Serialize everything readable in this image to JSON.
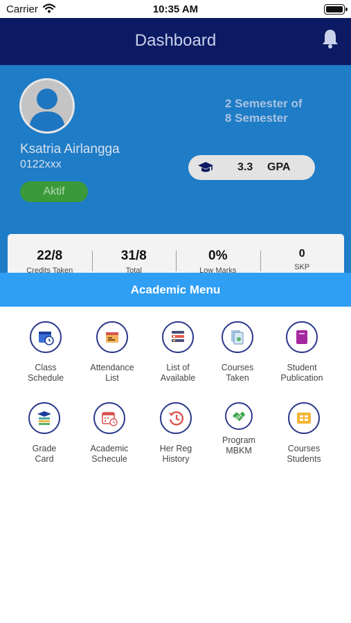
{
  "status_bar": {
    "carrier": "Carrier",
    "time": "10:35 AM"
  },
  "nav": {
    "title": "Dashboard",
    "notification_icon": "bell-icon"
  },
  "profile": {
    "name": "Ksatria Airlangga",
    "id": "0122xxx",
    "status": "Aktif",
    "semester_line1": "2 Semester of",
    "semester_line2": "8 Semester",
    "gpa_value": "3.3",
    "gpa_label": "GPA"
  },
  "stats": [
    {
      "value": "22/8",
      "label": "Credits Taken"
    },
    {
      "value": "31/8",
      "label": "Total"
    },
    {
      "value": "0%",
      "label": "Low Marks"
    },
    {
      "value": "0",
      "label": "SKP"
    }
  ],
  "menu": {
    "title": "Academic Menu",
    "items": [
      {
        "line1": "Class",
        "line2": "Schedule",
        "icon": "calendar-clock-icon"
      },
      {
        "line1": "Attendance",
        "line2": "List",
        "icon": "attendance-icon"
      },
      {
        "line1": "List of",
        "line2": "Available",
        "icon": "list-icon"
      },
      {
        "line1": "Courses",
        "line2": "Taken",
        "icon": "documents-icon"
      },
      {
        "line1": "Student",
        "line2": "Publication",
        "icon": "book-icon"
      },
      {
        "line1": "Grade",
        "line2": "Card",
        "icon": "grade-card-icon"
      },
      {
        "line1": "Academic",
        "line2": "Schecule",
        "icon": "academic-calendar-icon"
      },
      {
        "line1": "Her Reg",
        "line2": "History",
        "icon": "history-icon"
      },
      {
        "line1": "Program",
        "line2": "MBKM",
        "icon": "handshake-icon"
      },
      {
        "line1": "Courses",
        "line2": "Students",
        "icon": "grid-icon"
      }
    ]
  },
  "colors": {
    "nav_bg": "#0c1a63",
    "hero_bg": "#1f7cc6",
    "menu_header_bg": "#2f9ef5",
    "status_badge": "#3a9a3a"
  }
}
